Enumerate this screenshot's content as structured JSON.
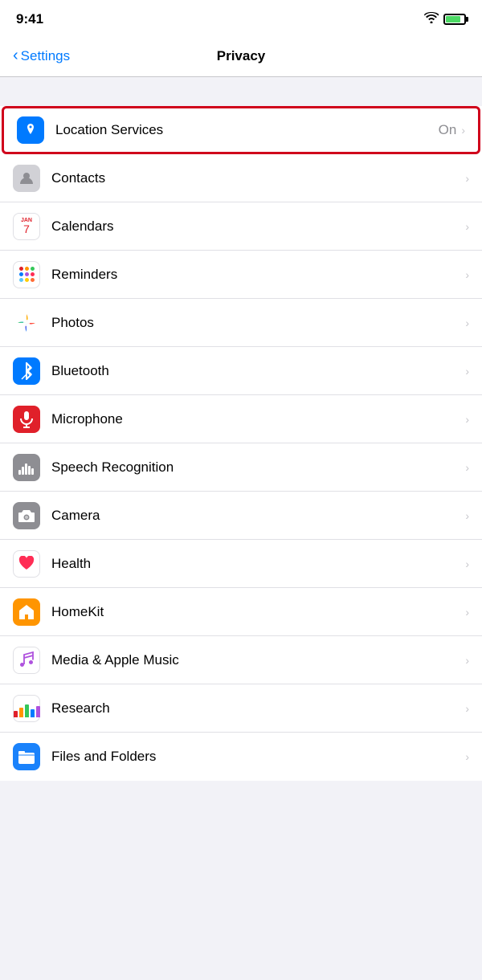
{
  "status": {
    "time": "9:41",
    "wifi": "wifi",
    "battery": "battery"
  },
  "nav": {
    "back_label": "Settings",
    "title": "Privacy"
  },
  "items": [
    {
      "id": "location-services",
      "label": "Location Services",
      "value": "On",
      "icon_type": "location",
      "highlighted": true
    },
    {
      "id": "contacts",
      "label": "Contacts",
      "value": "",
      "icon_type": "contacts",
      "highlighted": false
    },
    {
      "id": "calendars",
      "label": "Calendars",
      "value": "",
      "icon_type": "calendars",
      "highlighted": false
    },
    {
      "id": "reminders",
      "label": "Reminders",
      "value": "",
      "icon_type": "reminders",
      "highlighted": false
    },
    {
      "id": "photos",
      "label": "Photos",
      "value": "",
      "icon_type": "photos",
      "highlighted": false
    },
    {
      "id": "bluetooth",
      "label": "Bluetooth",
      "value": "",
      "icon_type": "bluetooth",
      "highlighted": false
    },
    {
      "id": "microphone",
      "label": "Microphone",
      "value": "",
      "icon_type": "microphone",
      "highlighted": false
    },
    {
      "id": "speech-recognition",
      "label": "Speech Recognition",
      "value": "",
      "icon_type": "speech",
      "highlighted": false
    },
    {
      "id": "camera",
      "label": "Camera",
      "value": "",
      "icon_type": "camera",
      "highlighted": false
    },
    {
      "id": "health",
      "label": "Health",
      "value": "",
      "icon_type": "health",
      "highlighted": false
    },
    {
      "id": "homekit",
      "label": "HomeKit",
      "value": "",
      "icon_type": "homekit",
      "highlighted": false
    },
    {
      "id": "media-apple-music",
      "label": "Media & Apple Music",
      "value": "",
      "icon_type": "music",
      "highlighted": false
    },
    {
      "id": "research",
      "label": "Research",
      "value": "",
      "icon_type": "research",
      "highlighted": false
    },
    {
      "id": "files-and-folders",
      "label": "Files and Folders",
      "value": "",
      "icon_type": "files",
      "highlighted": false
    }
  ]
}
